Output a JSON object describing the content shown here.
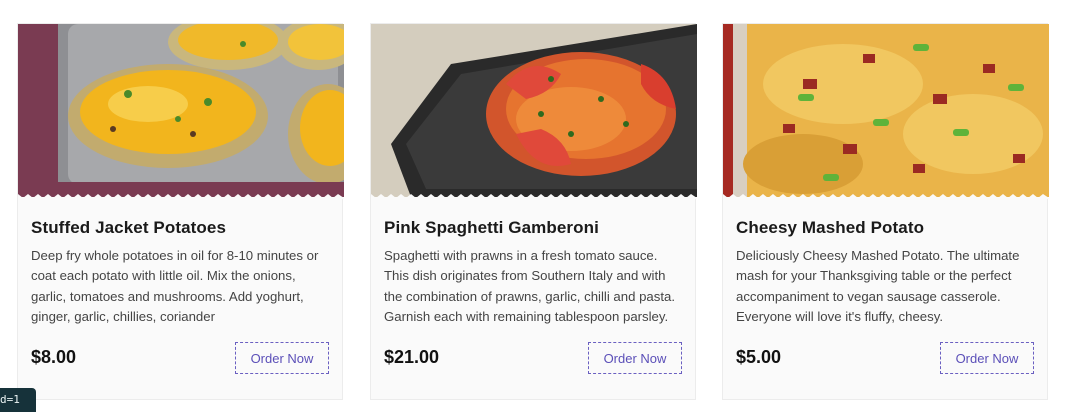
{
  "cards": [
    {
      "title": "Stuffed Jacket Potatoes",
      "description": "Deep fry whole potatoes in oil for 8-10 minutes or coat each potato with little oil. Mix the onions, garlic, tomatoes and mushrooms. Add yoghurt, ginger, garlic, chillies, coriander",
      "price": "$8.00",
      "button_label": "Order Now"
    },
    {
      "title": "Pink Spaghetti Gamberoni",
      "description": "Spaghetti with prawns in a fresh tomato sauce. This dish originates from Southern Italy and with the combination of prawns, garlic, chilli and pasta. Garnish each with remaining tablespoon parsley.",
      "price": "$21.00",
      "button_label": "Order Now"
    },
    {
      "title": "Cheesy Mashed Potato",
      "description": "Deliciously Cheesy Mashed Potato. The ultimate mash for your Thanksgiving table or the perfect accompaniment to vegan sausage casserole. Everyone will love it's fluffy, cheesy.",
      "price": "$5.00",
      "button_label": "Order Now"
    }
  ],
  "debug_badge": "d=1",
  "colors": {
    "button_accent": "#6a5fc1",
    "card_bg": "#fafafa"
  }
}
